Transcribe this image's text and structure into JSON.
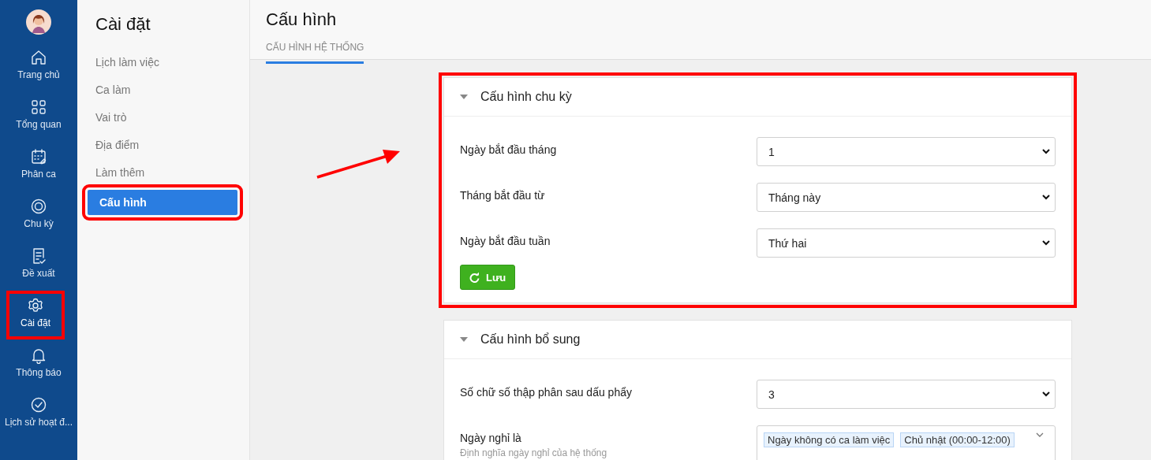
{
  "rail": {
    "items": [
      {
        "label": "Trang chủ",
        "selected": false,
        "highlighted": false
      },
      {
        "label": "Tổng quan",
        "selected": false,
        "highlighted": false
      },
      {
        "label": "Phân ca",
        "selected": false,
        "highlighted": false
      },
      {
        "label": "Chu kỳ",
        "selected": false,
        "highlighted": false
      },
      {
        "label": "Đề xuất",
        "selected": false,
        "highlighted": false
      },
      {
        "label": "Cài đặt",
        "selected": true,
        "highlighted": true
      },
      {
        "label": "Thông báo",
        "selected": false,
        "highlighted": false
      },
      {
        "label": "Lịch sử hoạt đ...",
        "selected": false,
        "highlighted": false
      }
    ]
  },
  "settings_menu": {
    "title": "Cài đặt",
    "items": [
      {
        "label": "Lịch làm việc",
        "selected": false,
        "highlighted": false
      },
      {
        "label": "Ca làm",
        "selected": false,
        "highlighted": false
      },
      {
        "label": "Vai trò",
        "selected": false,
        "highlighted": false
      },
      {
        "label": "Địa điểm",
        "selected": false,
        "highlighted": false
      },
      {
        "label": "Làm thêm",
        "selected": false,
        "highlighted": false
      },
      {
        "label": "Cấu hình",
        "selected": true,
        "highlighted": true
      }
    ]
  },
  "page": {
    "title": "Cấu hình",
    "tabs": [
      {
        "label": "CẤU HÌNH HỆ THỐNG",
        "selected": true
      }
    ]
  },
  "cards": [
    {
      "title": "Cấu hình chu kỳ",
      "expanded": true,
      "highlighted": true,
      "fields": [
        {
          "kind": "select",
          "label": "Ngày bắt đầu tháng",
          "value": "1"
        },
        {
          "kind": "select",
          "label": "Tháng bắt đầu từ",
          "value": "Tháng này"
        },
        {
          "kind": "select",
          "label": "Ngày bắt đầu tuần",
          "value": "Thứ hai"
        }
      ],
      "button": "Lưu"
    },
    {
      "title": "Cấu hình bổ sung",
      "expanded": true,
      "highlighted": false,
      "fields": [
        {
          "kind": "select",
          "label": "Số chữ số thập phân sau dấu phẩy",
          "value": "3"
        },
        {
          "kind": "multiselect",
          "label": "Ngày nghỉ là",
          "hint": "Định nghĩa ngày nghỉ của hệ thống",
          "tags": [
            "Ngày không có ca làm việc",
            "Chủ nhật (00:00-12:00)"
          ]
        }
      ]
    }
  ]
}
